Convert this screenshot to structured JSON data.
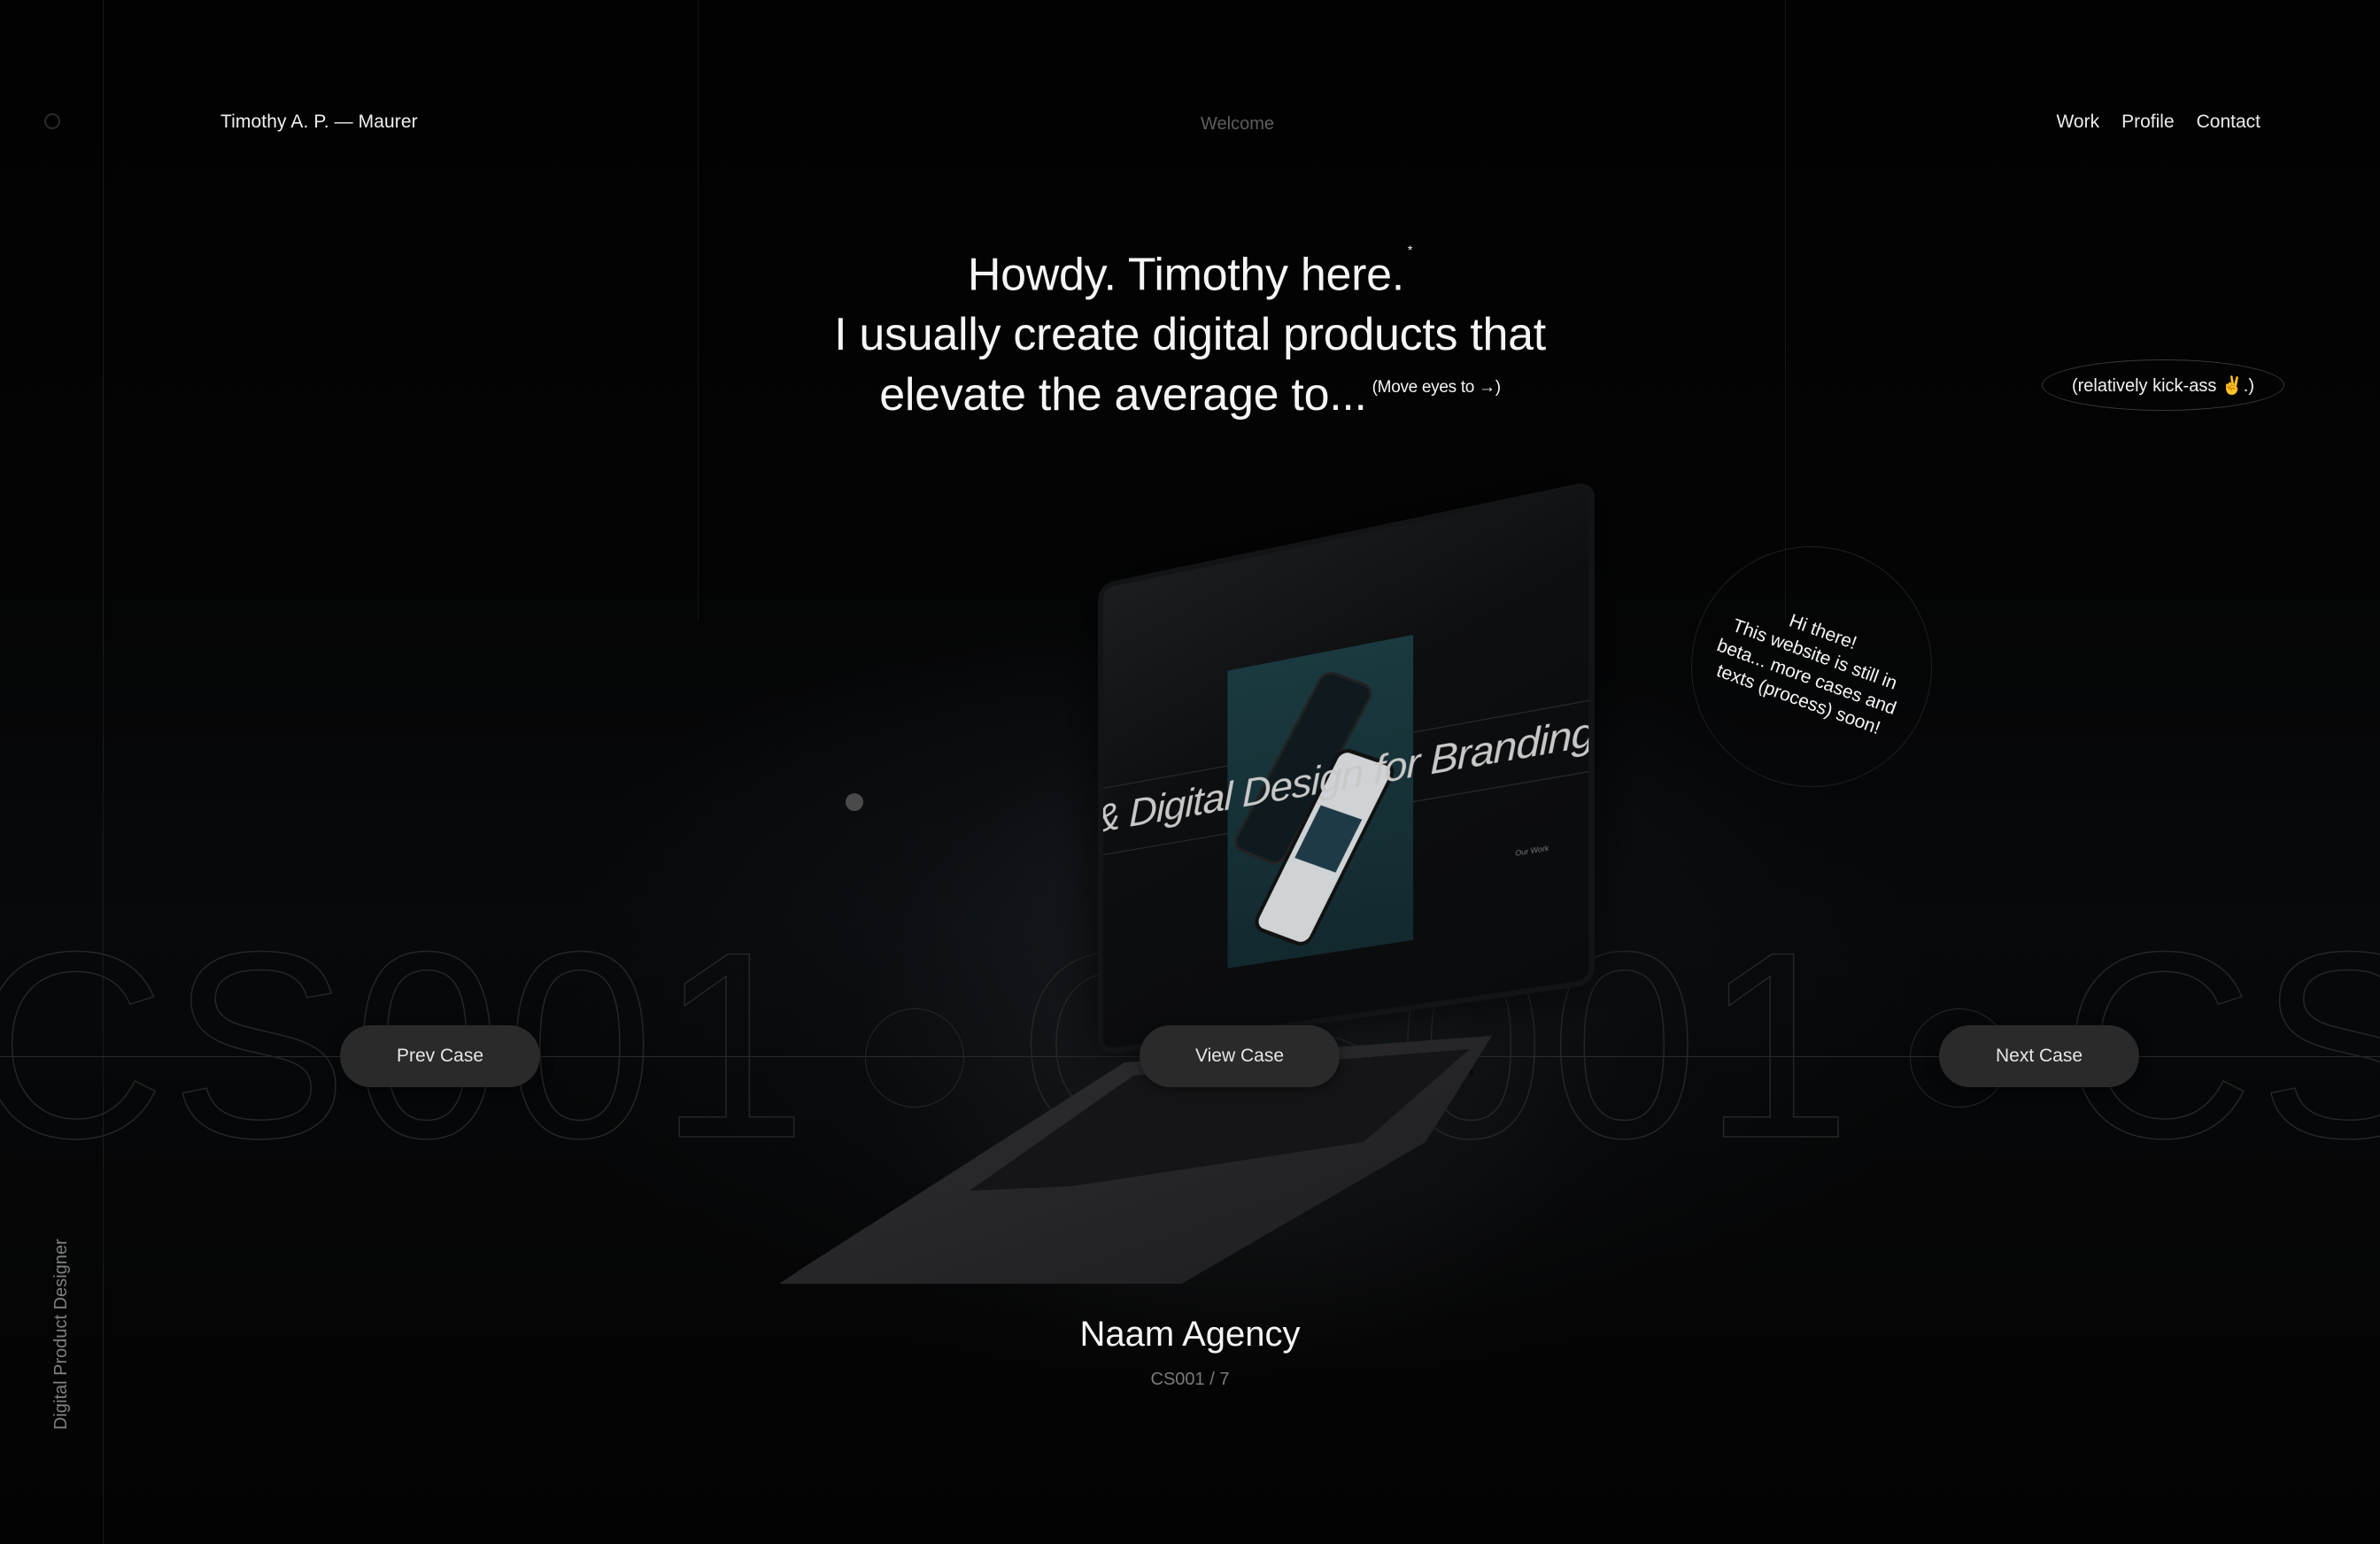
{
  "header": {
    "brand": "Timothy A. P. — Maurer",
    "center_label": "Welcome",
    "nav": [
      {
        "label": "Work"
      },
      {
        "label": "Profile"
      },
      {
        "label": "Contact"
      }
    ]
  },
  "hero": {
    "line1": "Howdy. Timothy here.",
    "line1_mark": "*",
    "line2": "I usually create digital products that",
    "line3": "elevate the average to...",
    "aside": "(Move eyes to →)",
    "pill_note": "(relatively kick-ass ✌️.)"
  },
  "beta_note": {
    "lines": [
      "Hi there!",
      "This website is still in",
      "beta... more cases and",
      "texts (process) soon!"
    ]
  },
  "carousel": {
    "background_text": "CS001",
    "prev_label": "Prev Case",
    "view_label": "View Case",
    "next_label": "Next Case",
    "case_title": "Naam Agency",
    "case_counter": "CS001 / 7",
    "screen_headline": "& Digital Design for Branding & D",
    "screen_link": "Our Work"
  },
  "side": {
    "role": "Digital Product Designer"
  },
  "colors": {
    "background": "#030303",
    "button": "#2a2a2a",
    "muted_text": "#7a7a7a",
    "accent_teal": "#1a3a40"
  }
}
